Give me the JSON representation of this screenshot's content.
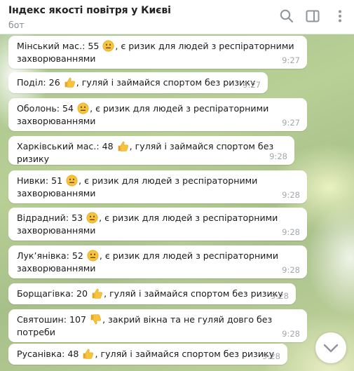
{
  "header": {
    "title": "Індекс якості повітря у Києві",
    "subtitle": "бот",
    "icons": [
      "search-icon",
      "sidebar-icon",
      "more-vertical-icon"
    ]
  },
  "messages": [
    {
      "text_before": "Мінський мас.: 55",
      "emoji": "neutral-face",
      "text_after": ", є ризик для людей з респіраторними захворюваннями",
      "time": "9:27"
    },
    {
      "text_before": "Поділ: 26",
      "emoji": "thumbs-up",
      "text_after": ", гуляй і займайся спортом без ризику",
      "time": "9:27"
    },
    {
      "text_before": "Оболонь: 54",
      "emoji": "neutral-face",
      "text_after": ", є ризик для людей з респіраторними захворюваннями",
      "time": "9:27"
    },
    {
      "text_before": "Харківський мас.: 48",
      "emoji": "thumbs-up",
      "text_after": ", гуляй і займайся спортом без ризику",
      "time": "9:28"
    },
    {
      "text_before": "Нивки: 51",
      "emoji": "neutral-face",
      "text_after": ", є ризик для людей з респіраторними захворюваннями",
      "time": "9:28"
    },
    {
      "text_before": "Відрадний: 53",
      "emoji": "neutral-face",
      "text_after": ", є ризик для людей з респіраторними захворюваннями",
      "time": "9:28"
    },
    {
      "text_before": "Лук’янівка: 52",
      "emoji": "neutral-face",
      "text_after": ", є ризик для людей з респіраторними захворюваннями",
      "time": "9:28"
    },
    {
      "text_before": "Борщагівка: 20",
      "emoji": "thumbs-up",
      "text_after": ", гуляй і займайся спортом без ризику",
      "time": "9:28"
    },
    {
      "text_before": "Святошин: 107",
      "emoji": "thumbs-down",
      "text_after": ", закрий вікна та не гуляй довго без потреби",
      "time": "9:28"
    },
    {
      "text_before": "Русанівка: 48",
      "emoji": "thumbs-up",
      "text_after": ", гуляй і займайся спортом без ризику",
      "time": "9:28"
    }
  ]
}
